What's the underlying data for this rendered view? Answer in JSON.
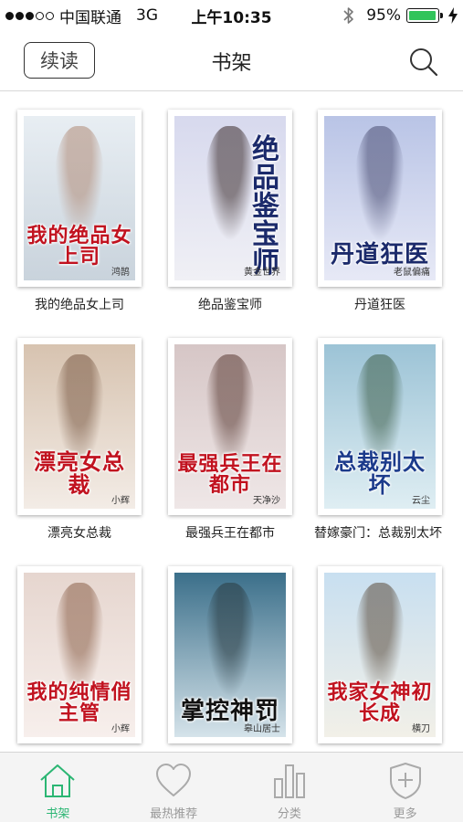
{
  "status_bar": {
    "carrier": "中国联通",
    "network": "3G",
    "time": "上午10:35",
    "battery_percent": "95%",
    "battery_level": 0.95,
    "signal_bars": 3,
    "signal_total": 5
  },
  "nav": {
    "continue_label": "续读",
    "title": "书架"
  },
  "books": [
    {
      "label": "我的绝品女上司",
      "cover_title": "我的绝品女上司",
      "cover_author": "鸿鹄",
      "title_color": "#c1121f",
      "bg_top": "#e8eef3",
      "bg_bottom": "#c9d3dc",
      "figure": "#b08a76",
      "vertical": false
    },
    {
      "label": "绝品鉴宝师",
      "cover_title": "绝品鉴宝师",
      "cover_author": "黄金世界",
      "title_color": "#1b2a6b",
      "bg_top": "#d7d9ee",
      "bg_bottom": "#f0f0f5",
      "figure": "#3a2b2b",
      "vertical": true
    },
    {
      "label": "丹道狂医",
      "cover_title": "丹道狂医",
      "cover_author": "老鼠偏痛",
      "title_color": "#1b2a6b",
      "bg_top": "#b9c4e6",
      "bg_bottom": "#e7e9f6",
      "figure": "#4a4d72",
      "vertical": false
    },
    {
      "label": "漂亮女总裁",
      "cover_title": "漂亮女总裁",
      "cover_author": "小辉",
      "title_color": "#c1121f",
      "bg_top": "#d7c3b0",
      "bg_bottom": "#f3ece6",
      "figure": "#7a5a45",
      "vertical": false
    },
    {
      "label": "最强兵王在都市",
      "cover_title": "最强兵王在都市",
      "cover_author": "天净沙",
      "title_color": "#c1121f",
      "bg_top": "#d6c6c6",
      "bg_bottom": "#efe7e7",
      "figure": "#5a3b34",
      "vertical": false
    },
    {
      "label": "替嫁豪门：总裁别太坏",
      "cover_title": "总裁别太坏",
      "cover_author": "云尘",
      "title_color": "#1b3a8b",
      "bg_top": "#9cc3d6",
      "bg_bottom": "#dfeef3",
      "figure": "#3f5f4a",
      "vertical": false
    },
    {
      "label": "",
      "cover_title": "我的纯情俏主管",
      "cover_author": "小辉",
      "title_color": "#c1121f",
      "bg_top": "#e6d6cf",
      "bg_bottom": "#f7efec",
      "figure": "#8a5f48",
      "vertical": false
    },
    {
      "label": "",
      "cover_title": "掌控神罚",
      "cover_author": "皋山居士",
      "title_color": "#111111",
      "bg_top": "#3b6f8a",
      "bg_bottom": "#d5e3ea",
      "figure": "#2a3a40",
      "vertical": false
    },
    {
      "label": "",
      "cover_title": "我家女神初长成",
      "cover_author": "横刀",
      "title_color": "#c1121f",
      "bg_top": "#c8dff0",
      "bg_bottom": "#f2f0e8",
      "figure": "#5a4a3a",
      "vertical": false
    }
  ],
  "tabs": [
    {
      "label": "书架",
      "icon": "house-icon",
      "active": true
    },
    {
      "label": "最热推荐",
      "icon": "heart-icon",
      "active": false
    },
    {
      "label": "分类",
      "icon": "bar-chart-icon",
      "active": false
    },
    {
      "label": "更多",
      "icon": "shield-plus-icon",
      "active": false
    }
  ],
  "colors": {
    "accent": "#2bb673",
    "battery_fill": "#31c45a"
  }
}
